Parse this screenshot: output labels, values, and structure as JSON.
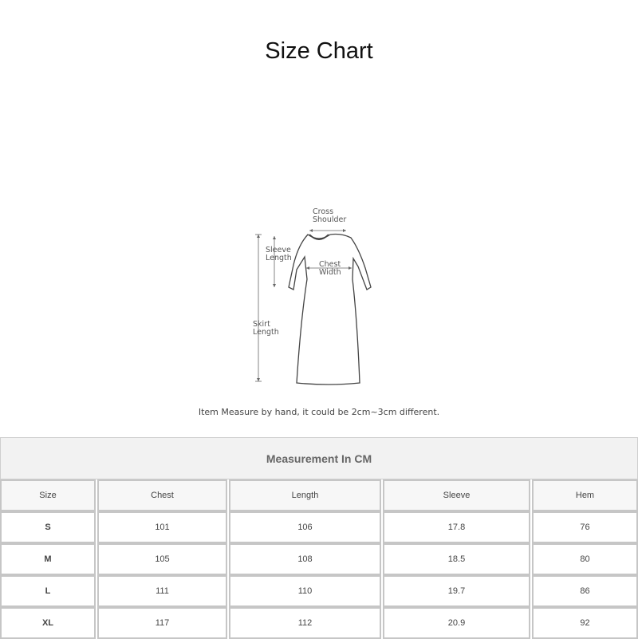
{
  "title": "Size Chart",
  "diagram": {
    "labels": {
      "cross_shoulder_1": "Cross",
      "cross_shoulder_2": "Shoulder",
      "sleeve_length_1": "Sleeve",
      "sleeve_length_2": "Length",
      "chest_width_1": "Chest",
      "chest_width_2": "Width",
      "skirt_length_1": "Skirt",
      "skirt_length_2": "Length"
    }
  },
  "note": "Item Measure by hand, it could be 2cm~3cm different.",
  "table": {
    "caption": "Measurement In CM",
    "columns": [
      "Size",
      "Chest",
      "Length",
      "Sleeve",
      "Hem"
    ],
    "rows": [
      [
        "S",
        "101",
        "106",
        "17.8",
        "76"
      ],
      [
        "M",
        "105",
        "108",
        "18.5",
        "80"
      ],
      [
        "L",
        "111",
        "110",
        "19.7",
        "86"
      ],
      [
        "XL",
        "117",
        "112",
        "20.9",
        "92"
      ]
    ]
  }
}
